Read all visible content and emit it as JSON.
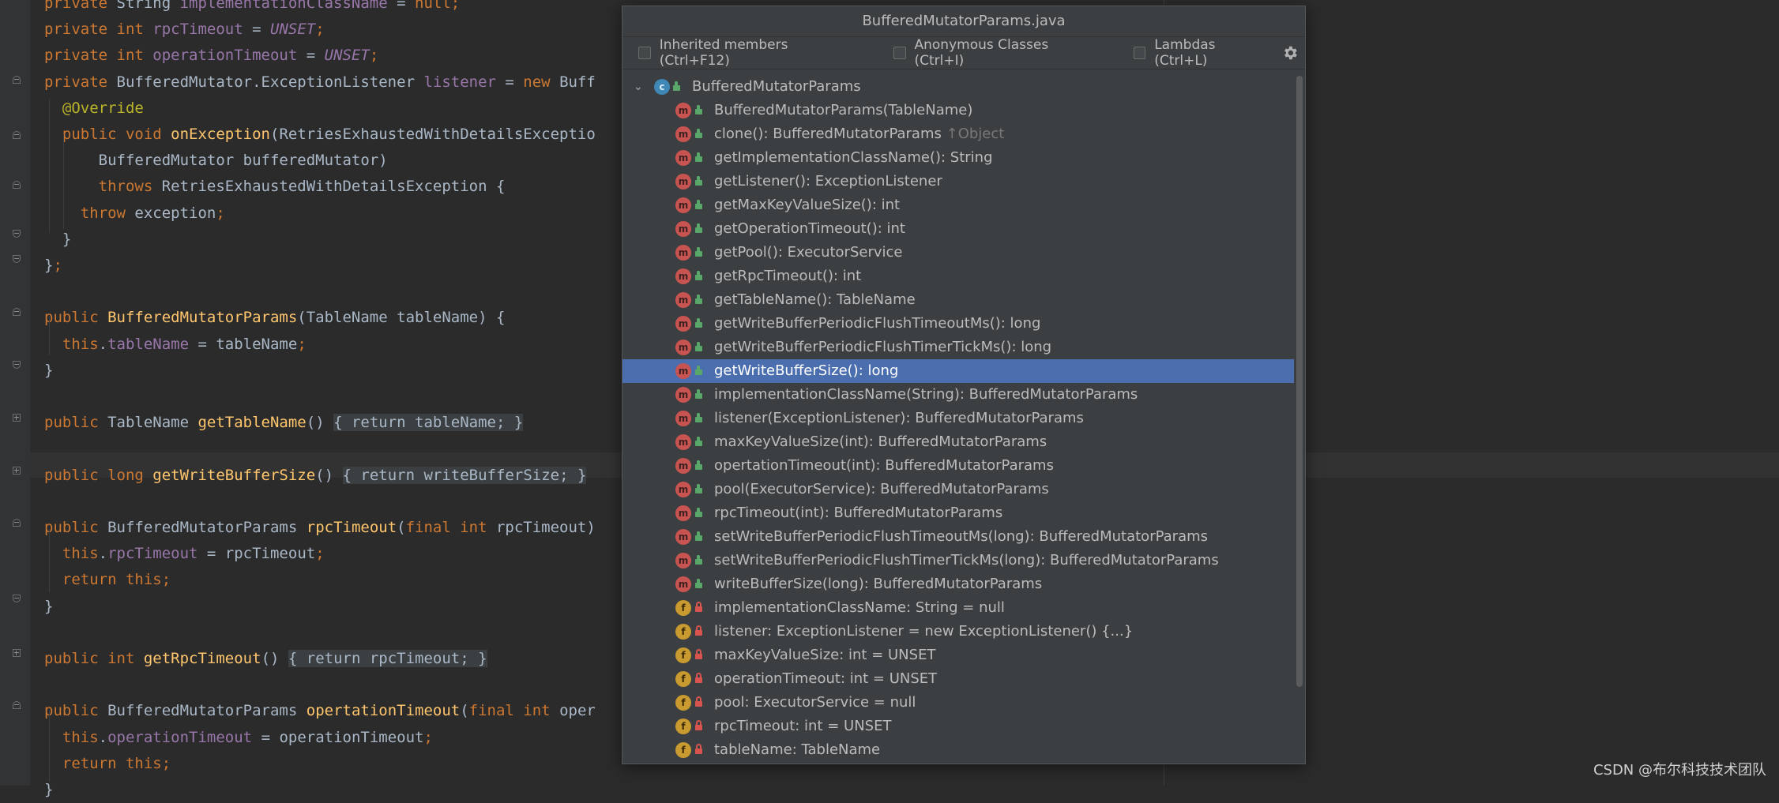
{
  "editor": {
    "lines": [
      [
        {
          "t": "private ",
          "c": "kw"
        },
        {
          "t": "String ",
          "c": ""
        },
        {
          "t": "implementationClassName",
          "c": "fld"
        },
        {
          "t": " = ",
          "c": ""
        },
        {
          "t": "null",
          "c": "kw"
        },
        {
          "t": ";",
          "c": "kw"
        }
      ],
      [
        {
          "t": "private int ",
          "c": "kw"
        },
        {
          "t": "rpcTimeout",
          "c": "fld"
        },
        {
          "t": " = ",
          "c": ""
        },
        {
          "t": "UNSET",
          "c": "fld it"
        },
        {
          "t": ";",
          "c": "kw"
        }
      ],
      [
        {
          "t": "private int ",
          "c": "kw"
        },
        {
          "t": "operationTimeout",
          "c": "fld"
        },
        {
          "t": " = ",
          "c": ""
        },
        {
          "t": "UNSET",
          "c": "fld it"
        },
        {
          "t": ";",
          "c": "kw"
        }
      ],
      [
        {
          "t": "private ",
          "c": "kw"
        },
        {
          "t": "BufferedMutator.ExceptionListener ",
          "c": ""
        },
        {
          "t": "listener",
          "c": "fld"
        },
        {
          "t": " = ",
          "c": ""
        },
        {
          "t": "new ",
          "c": "kw"
        },
        {
          "t": "Buff",
          "c": ""
        }
      ],
      [
        {
          "t": "  @Override",
          "c": "ann"
        }
      ],
      [
        {
          "t": "  public void ",
          "c": "kw"
        },
        {
          "t": "onException",
          "c": "fn"
        },
        {
          "t": "(RetriesExhaustedWithDetailsExceptio",
          "c": ""
        }
      ],
      [
        {
          "t": "      BufferedMutator bufferedMutator)",
          "c": ""
        }
      ],
      [
        {
          "t": "      throws ",
          "c": "kw"
        },
        {
          "t": "RetriesExhaustedWithDetailsException {",
          "c": ""
        }
      ],
      [
        {
          "t": "    throw ",
          "c": "kw"
        },
        {
          "t": "exception",
          "c": ""
        },
        {
          "t": ";",
          "c": "kw"
        }
      ],
      [
        {
          "t": "  }",
          "c": ""
        }
      ],
      [
        {
          "t": "}",
          "c": ""
        },
        {
          "t": ";",
          "c": "kw"
        }
      ],
      [],
      [
        {
          "t": "public ",
          "c": "kw"
        },
        {
          "t": "BufferedMutatorParams",
          "c": "fn"
        },
        {
          "t": "(TableName tableName) {",
          "c": ""
        }
      ],
      [
        {
          "t": "  this",
          "c": "kw"
        },
        {
          "t": ".",
          "c": ""
        },
        {
          "t": "tableName",
          "c": "fld"
        },
        {
          "t": " = tableName",
          "c": ""
        },
        {
          "t": ";",
          "c": "kw"
        }
      ],
      [
        {
          "t": "}",
          "c": ""
        }
      ],
      [],
      [
        {
          "t": "public ",
          "c": "kw"
        },
        {
          "t": "TableName ",
          "c": ""
        },
        {
          "t": "getTableName",
          "c": "fn"
        },
        {
          "t": "() ",
          "c": ""
        },
        {
          "t": "{ ",
          "c": "hl"
        },
        {
          "t": "return ",
          "c": "kw hl"
        },
        {
          "t": "tableName",
          "c": "fld hl"
        },
        {
          "t": "; ",
          "c": "kw hl"
        },
        {
          "t": "}",
          "c": "hl"
        }
      ],
      [],
      [
        {
          "t": "public long ",
          "c": "kw"
        },
        {
          "t": "getWriteBufferSize",
          "c": "fn"
        },
        {
          "t": "() ",
          "c": ""
        },
        {
          "t": "{ ",
          "c": "hl"
        },
        {
          "t": "return ",
          "c": "kw hl"
        },
        {
          "t": "writeBufferSize",
          "c": "fld hl"
        },
        {
          "t": "; ",
          "c": "kw hl"
        },
        {
          "t": "}",
          "c": "hl"
        }
      ],
      [],
      [
        {
          "t": "public ",
          "c": "kw"
        },
        {
          "t": "BufferedMutatorParams ",
          "c": ""
        },
        {
          "t": "rpcTimeout",
          "c": "fn"
        },
        {
          "t": "(",
          "c": ""
        },
        {
          "t": "final int ",
          "c": "kw"
        },
        {
          "t": "rpcTimeout)",
          "c": ""
        }
      ],
      [
        {
          "t": "  this",
          "c": "kw"
        },
        {
          "t": ".",
          "c": ""
        },
        {
          "t": "rpcTimeout",
          "c": "fld"
        },
        {
          "t": " = rpcTimeout",
          "c": ""
        },
        {
          "t": ";",
          "c": "kw"
        }
      ],
      [
        {
          "t": "  return this",
          "c": "kw"
        },
        {
          "t": ";",
          "c": "kw"
        }
      ],
      [
        {
          "t": "}",
          "c": ""
        }
      ],
      [],
      [
        {
          "t": "public int ",
          "c": "kw"
        },
        {
          "t": "getRpcTimeout",
          "c": "fn"
        },
        {
          "t": "() ",
          "c": ""
        },
        {
          "t": "{ ",
          "c": "hl"
        },
        {
          "t": "return ",
          "c": "kw hl"
        },
        {
          "t": "rpcTimeout",
          "c": "fld hl"
        },
        {
          "t": "; ",
          "c": "kw hl"
        },
        {
          "t": "}",
          "c": "hl"
        }
      ],
      [],
      [
        {
          "t": "public ",
          "c": "kw"
        },
        {
          "t": "BufferedMutatorParams ",
          "c": ""
        },
        {
          "t": "opertationTimeout",
          "c": "fn"
        },
        {
          "t": "(",
          "c": ""
        },
        {
          "t": "final int ",
          "c": "kw"
        },
        {
          "t": "oper",
          "c": ""
        }
      ],
      [
        {
          "t": "  this",
          "c": "kw"
        },
        {
          "t": ".",
          "c": ""
        },
        {
          "t": "operationTimeout",
          "c": "fld"
        },
        {
          "t": " = operationTimeout",
          "c": ""
        },
        {
          "t": ";",
          "c": "kw"
        }
      ],
      [
        {
          "t": "  return this",
          "c": "kw"
        },
        {
          "t": ";",
          "c": "kw"
        }
      ],
      [
        {
          "t": "}",
          "c": ""
        }
      ]
    ]
  },
  "popup": {
    "title": "BufferedMutatorParams.java",
    "options": [
      {
        "label": "Inherited members (Ctrl+F12)",
        "checked": false
      },
      {
        "label": "Anonymous Classes (Ctrl+I)",
        "checked": false
      },
      {
        "label": "Lambdas (Ctrl+L)",
        "checked": false
      }
    ],
    "settings_icon": "gear-icon",
    "root": {
      "label": "BufferedMutatorParams",
      "icon": "class"
    },
    "items": [
      {
        "kind": "m",
        "vis": "pub",
        "label": "BufferedMutatorParams(TableName)"
      },
      {
        "kind": "m",
        "vis": "pub",
        "label": "clone(): BufferedMutatorParams",
        "suffix": " ↑Object"
      },
      {
        "kind": "m",
        "vis": "pub",
        "label": "getImplementationClassName(): String"
      },
      {
        "kind": "m",
        "vis": "pub",
        "label": "getListener(): ExceptionListener"
      },
      {
        "kind": "m",
        "vis": "pub",
        "label": "getMaxKeyValueSize(): int"
      },
      {
        "kind": "m",
        "vis": "pub",
        "label": "getOperationTimeout(): int"
      },
      {
        "kind": "m",
        "vis": "pub",
        "label": "getPool(): ExecutorService"
      },
      {
        "kind": "m",
        "vis": "pub",
        "label": "getRpcTimeout(): int"
      },
      {
        "kind": "m",
        "vis": "pub",
        "label": "getTableName(): TableName"
      },
      {
        "kind": "m",
        "vis": "pub",
        "label": "getWriteBufferPeriodicFlushTimeoutMs(): long"
      },
      {
        "kind": "m",
        "vis": "pub",
        "label": "getWriteBufferPeriodicFlushTimerTickMs(): long"
      },
      {
        "kind": "m",
        "vis": "pub",
        "label": "getWriteBufferSize(): long",
        "selected": true
      },
      {
        "kind": "m",
        "vis": "pub",
        "label": "implementationClassName(String): BufferedMutatorParams"
      },
      {
        "kind": "m",
        "vis": "pub",
        "label": "listener(ExceptionListener): BufferedMutatorParams"
      },
      {
        "kind": "m",
        "vis": "pub",
        "label": "maxKeyValueSize(int): BufferedMutatorParams"
      },
      {
        "kind": "m",
        "vis": "pub",
        "label": "opertationTimeout(int): BufferedMutatorParams"
      },
      {
        "kind": "m",
        "vis": "pub",
        "label": "pool(ExecutorService): BufferedMutatorParams"
      },
      {
        "kind": "m",
        "vis": "pub",
        "label": "rpcTimeout(int): BufferedMutatorParams"
      },
      {
        "kind": "m",
        "vis": "pub",
        "label": "setWriteBufferPeriodicFlushTimeoutMs(long): BufferedMutatorParams"
      },
      {
        "kind": "m",
        "vis": "pub",
        "label": "setWriteBufferPeriodicFlushTimerTickMs(long): BufferedMutatorParams"
      },
      {
        "kind": "m",
        "vis": "pub",
        "label": "writeBufferSize(long): BufferedMutatorParams"
      },
      {
        "kind": "f",
        "vis": "priv",
        "label": "implementationClassName: String = null"
      },
      {
        "kind": "f",
        "vis": "priv",
        "label": "listener: ExceptionListener = new ExceptionListener() {...}"
      },
      {
        "kind": "f",
        "vis": "priv",
        "label": "maxKeyValueSize: int = UNSET"
      },
      {
        "kind": "f",
        "vis": "priv",
        "label": "operationTimeout: int = UNSET"
      },
      {
        "kind": "f",
        "vis": "priv",
        "label": "pool: ExecutorService = null"
      },
      {
        "kind": "f",
        "vis": "priv",
        "label": "rpcTimeout: int = UNSET"
      },
      {
        "kind": "f",
        "vis": "priv",
        "label": "tableName: TableName"
      }
    ]
  },
  "watermark": "CSDN @布尔科技技术团队",
  "colors": {
    "selection": "#4b6eaf",
    "keyword": "#cc7832",
    "field": "#9876aa",
    "function": "#ffc66d"
  }
}
